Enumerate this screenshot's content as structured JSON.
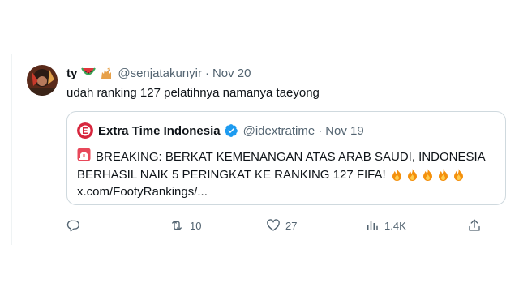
{
  "tweet": {
    "name": "ty",
    "emojis": [
      "watermelon-emoji",
      "cat-emoji"
    ],
    "handle": "@senjatakunyir",
    "separator": "·",
    "date": "Nov 20",
    "text": "udah ranking 127 pelatihnya namanya taeyong"
  },
  "quote": {
    "name": "Extra Time Indonesia",
    "verified": true,
    "handle": "@idextratime",
    "separator": "·",
    "date": "Nov 19",
    "line1": "BREAKING: BERKAT KEMENANGAN ATAS ARAB SAUDI, INDONESIA",
    "line2": "BERHASIL NAIK 5 PERINGKAT KE RANKING 127 FIFA!",
    "line3": "x.com/FootyRankings/...",
    "prefix_icon": "siren-emoji",
    "suffix_icons": [
      "fire-emoji",
      "fire-emoji",
      "fire-emoji",
      "fire-emoji",
      "fire-emoji"
    ]
  },
  "actions": {
    "reply_count": "",
    "retweet_count": "10",
    "like_count": "27",
    "views_count": "1.4K"
  },
  "colors": {
    "text": "#0f1419",
    "muted": "#536471",
    "border": "#cfd9de",
    "verified": "#1d9bf0",
    "brand_red": "#d7263d"
  }
}
